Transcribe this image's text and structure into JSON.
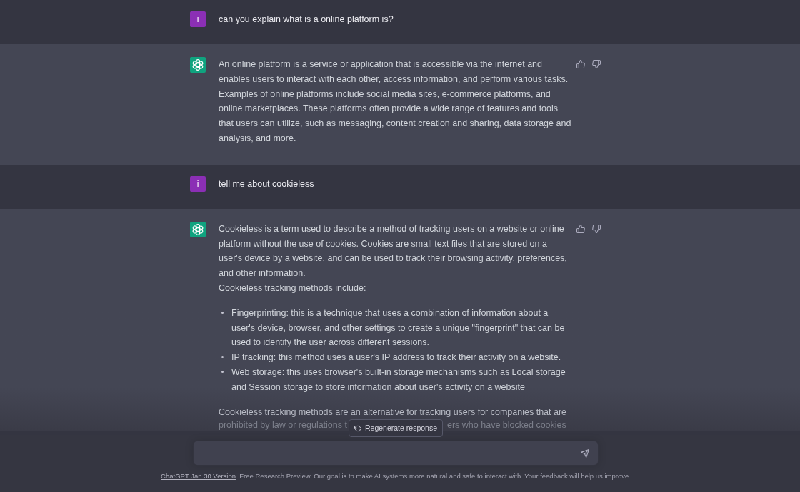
{
  "conversation": [
    {
      "kind": "user",
      "avatar": "i",
      "text": "can you explain what is a online platform is?"
    },
    {
      "kind": "assistant",
      "blocks": [
        {
          "kind": "paragraph",
          "text": "An online platform is a service or application that is accessible via the internet and enables users to interact with each other, access information, and perform various tasks. Examples of online platforms include social media sites, e-commerce platforms, and online marketplaces. These platforms often provide a wide range of features and tools that users can utilize, such as messaging, content creation and sharing, data storage and analysis, and more."
        }
      ]
    },
    {
      "kind": "user",
      "avatar": "i",
      "text": "tell me about cookieless"
    },
    {
      "kind": "assistant",
      "blocks": [
        {
          "kind": "paragraph",
          "text": "Cookieless is a term used to describe a method of tracking users on a website or online platform without the use of cookies. Cookies are small text files that are stored on a user's device by a website, and can be used to track their browsing activity, preferences, and other information."
        },
        {
          "kind": "line",
          "text": "Cookieless tracking methods include:"
        },
        {
          "kind": "bullets",
          "items": [
            "Fingerprinting: this is a technique that uses a combination of information about a user's device, browser, and other settings to create a unique \"fingerprint\" that can be used to identify the user across different sessions.",
            "IP tracking: this method uses a user's IP address to track their activity on a website.",
            "Web storage: this uses browser's built-in storage mechanisms such as Local storage and Session storage to store information about user's activity on a website"
          ]
        },
        {
          "kind": "covered_paragraph",
          "line": "Cookieless tracking methods are an alternative for tracking users for companies that are",
          "fragments": [
            "prohibited by law or regulations t",
            "ers who have blocked cookies"
          ]
        }
      ]
    }
  ],
  "regenerate_button": {
    "label": "Regenerate response"
  },
  "footer": {
    "link": "ChatGPT Jan 30 Version",
    "text": ". Free Research Preview. Our goal is to make AI systems more natural and safe to interact with. Your feedback will help us improve."
  }
}
